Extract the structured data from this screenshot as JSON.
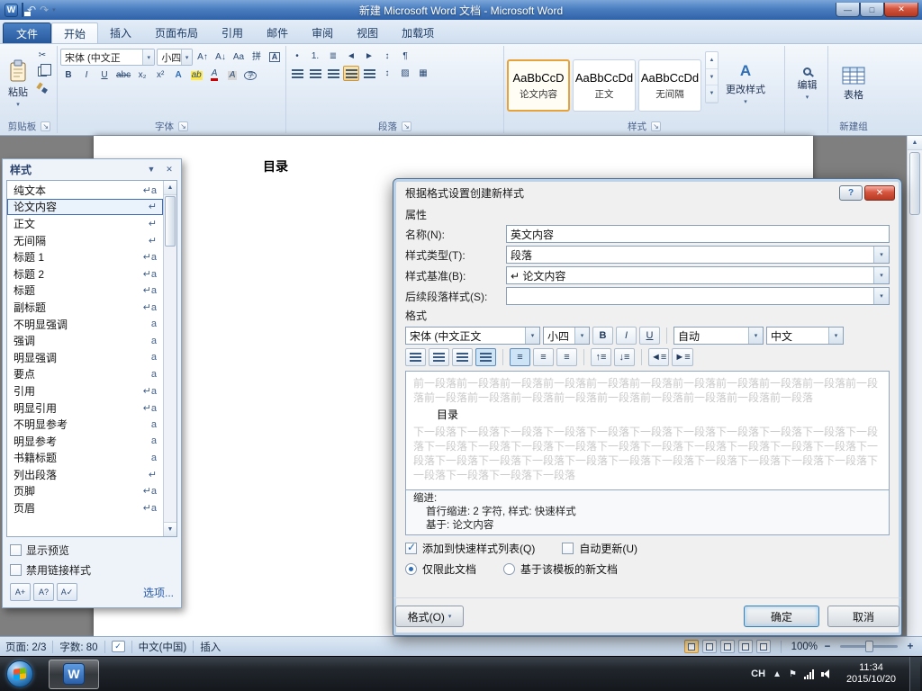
{
  "window": {
    "title": "新建 Microsoft Word 文档 - Microsoft Word"
  },
  "icons": {
    "dropdown": "▾",
    "launcher": "↘",
    "close": "✕",
    "minimize": "—",
    "maximize": "□",
    "help": "?",
    "undo": "↶",
    "redo": "↷",
    "cut": "✂",
    "pilcrow": "¶",
    "check": "✓",
    "bullets": "•",
    "numbering": "1.",
    "multilevel": "≣",
    "outdent": "◄",
    "indent": "►",
    "sort": "↕",
    "linespacing": "↕",
    "shading": "▨",
    "borders": "▦",
    "grow_font": "A↑",
    "shrink_font": "A↓",
    "change_case": "Aa",
    "pinyin": "拼",
    "char_border": "A",
    "bold": "B",
    "italic": "I",
    "underline": "U",
    "strike": "abc",
    "subscript": "x₂",
    "superscript": "x²",
    "text_effects": "A",
    "highlight": "ab",
    "font_color": "A",
    "char_shading": "A",
    "enclose": "字",
    "up": "▲",
    "down": "▼",
    "gallery_more": "▼",
    "hidden_icons": "▲",
    "flag": "⚑",
    "space_before": "↑≡",
    "space_after": "↓≡",
    "indent_dec": "◄≡",
    "indent_inc": "►≡"
  },
  "ribbon": {
    "file_tab": "文件",
    "tabs": [
      "开始",
      "插入",
      "页面布局",
      "引用",
      "邮件",
      "审阅",
      "视图",
      "加载项"
    ],
    "active_tab": "开始",
    "clipboard": {
      "label": "剪贴板",
      "paste": "粘贴"
    },
    "font": {
      "label": "字体",
      "name": "宋体 (中文正",
      "size": "小四"
    },
    "paragraph": {
      "label": "段落"
    },
    "styles": {
      "label": "样式",
      "gallery": [
        {
          "sample": "AaBbCcD",
          "name": "论文内容",
          "selected": true
        },
        {
          "sample": "AaBbCcDd",
          "name": "正文",
          "selected": false
        },
        {
          "sample": "AaBbCcDd",
          "name": "无间隔",
          "selected": false
        }
      ],
      "change_styles": "更改样式"
    },
    "editing": {
      "label": "编辑"
    },
    "newgroup": {
      "label": "新建组",
      "table": "表格"
    }
  },
  "document": {
    "heading": "目录"
  },
  "styles_pane": {
    "title": "样式",
    "items": [
      {
        "name": "纯文本",
        "mark": "↵a"
      },
      {
        "name": "论文内容",
        "mark": "↵",
        "selected": true
      },
      {
        "name": "正文",
        "mark": "↵"
      },
      {
        "name": "无间隔",
        "mark": "↵"
      },
      {
        "name": "标题 1",
        "mark": "↵a"
      },
      {
        "name": "标题 2",
        "mark": "↵a"
      },
      {
        "name": "标题",
        "mark": "↵a"
      },
      {
        "name": "副标题",
        "mark": "↵a"
      },
      {
        "name": "不明显强调",
        "mark": "a"
      },
      {
        "name": "强调",
        "mark": "a"
      },
      {
        "name": "明显强调",
        "mark": "a"
      },
      {
        "name": "要点",
        "mark": "a"
      },
      {
        "name": "引用",
        "mark": "↵a"
      },
      {
        "name": "明显引用",
        "mark": "↵a"
      },
      {
        "name": "不明显参考",
        "mark": "a"
      },
      {
        "name": "明显参考",
        "mark": "a"
      },
      {
        "name": "书籍标题",
        "mark": "a"
      },
      {
        "name": "列出段落",
        "mark": "↵"
      },
      {
        "name": "页脚",
        "mark": "↵a"
      },
      {
        "name": "页眉",
        "mark": "↵a"
      }
    ],
    "show_preview": "显示预览",
    "disable_linked_styles": "禁用链接样式",
    "new_style_btn": "A+",
    "style_inspector_btn": "A?",
    "manage_styles_btn": "A✓",
    "options": "选项..."
  },
  "dialog": {
    "title": "根据格式设置创建新样式",
    "properties_label": "属性",
    "fields": [
      {
        "label": "名称(N):",
        "value": "英文内容",
        "type": "text"
      },
      {
        "label": "样式类型(T):",
        "value": "段落",
        "type": "select"
      },
      {
        "label": "样式基准(B):",
        "value": "↵ 论文内容",
        "type": "select"
      },
      {
        "label": "后续段落样式(S):",
        "value": "",
        "type": "select"
      }
    ],
    "format_label": "格式",
    "toolbar": {
      "font_name": "宋体 (中文正文",
      "font_size": "小四",
      "color": "自动",
      "language": "中文"
    },
    "preview": {
      "before": "前一段落前一段落前一段落前一段落前一段落前一段落前一段落前一段落前一段落前一段落前一段落前一段落前一段落前一段落前一段落前一段落前一段落前一段落前一段落前一段落",
      "current": "目录",
      "after": "下一段落下一段落下一段落下一段落下一段落下一段落下一段落下一段落下一段落下一段落下一段落下一段落下一段落下一段落下一段落下一段落下一段落下一段落下一段落下一段落下一段落下一段落下一段落下一段落下一段落下一段落下一段落下一段落下一段落下一段落下一段落下一段落下一段落下一段落下一段落下一段落"
    },
    "description_line1": "缩进:",
    "description_line2": "首行缩进: 2 字符, 样式: 快速样式",
    "description_line3": "基于: 论文内容",
    "add_to_quick_list": "添加到快速样式列表(Q)",
    "auto_update": "自动更新(U)",
    "only_this_doc": "仅限此文档",
    "new_docs_based_on_template": "基于该模板的新文档",
    "format_button": "格式(O)",
    "ok": "确定",
    "cancel": "取消"
  },
  "status_bar": {
    "page": "页面: 2/3",
    "words": "字数: 80",
    "language": "中文(中国)",
    "insert_mode": "插入",
    "zoom": "100%"
  },
  "taskbar": {
    "input_indicator": "CH",
    "time": "11:34",
    "date": "2015/10/20"
  }
}
